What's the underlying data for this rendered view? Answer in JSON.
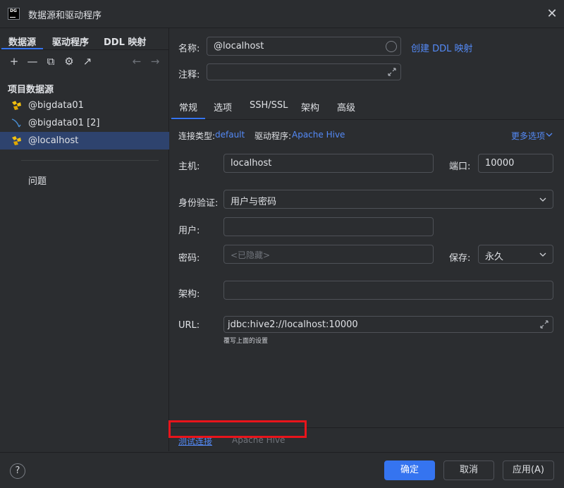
{
  "window": {
    "title": "数据源和驱动程序",
    "logo_text": "DG"
  },
  "left": {
    "tabs": [
      "数据源",
      "驱动程序",
      "DDL 映射"
    ],
    "tree_heading": "项目数据源",
    "items": [
      {
        "label": "@bigdata01",
        "icon": "hive-icon"
      },
      {
        "label": "@bigdata01 [2]",
        "icon": "mysql-icon"
      },
      {
        "label": "@localhost",
        "icon": "hive-icon",
        "selected": true
      }
    ],
    "problems_label": "问题"
  },
  "toolbar": {
    "add": "+",
    "remove": "—",
    "copy": "⧉",
    "settings": "⚙",
    "export": "↗",
    "back": "←",
    "forward": "→"
  },
  "form": {
    "name_label": "名称:",
    "name_value": "@localhost",
    "create_ddl_mapping": "创建 DDL 映射",
    "comment_label": "注释:",
    "comment_value": "",
    "tabs": [
      "常规",
      "选项",
      "SSH/SSL",
      "架构",
      "高级"
    ],
    "connection_type_label": "连接类型:",
    "connection_type_value": "default",
    "driver_label": "驱动程序:",
    "driver_value": "Apache Hive",
    "more_options": "更多选项",
    "host_label": "主机:",
    "host_value": "localhost",
    "port_label": "端口:",
    "port_value": "10000",
    "auth_label": "身份验证:",
    "auth_value": "用户与密码",
    "user_label": "用户:",
    "user_value": "",
    "password_label": "密码:",
    "password_value": "<已隐藏>",
    "save_label": "保存:",
    "save_value": "永久",
    "schema_label": "架构:",
    "schema_value": "",
    "url_label": "URL:",
    "url_value": "jdbc:hive2://localhost:10000",
    "url_note": "覆写上面的设置",
    "test_connection": "测试连接",
    "driver_footer": "Apache Hive"
  },
  "footer": {
    "help": "?",
    "ok": "确定",
    "cancel": "取消",
    "apply": "应用(A)"
  },
  "colors": {
    "accent": "#3574f0",
    "link": "#548af7",
    "highlight_box": "#e8141b",
    "selection": "#2e436e"
  }
}
